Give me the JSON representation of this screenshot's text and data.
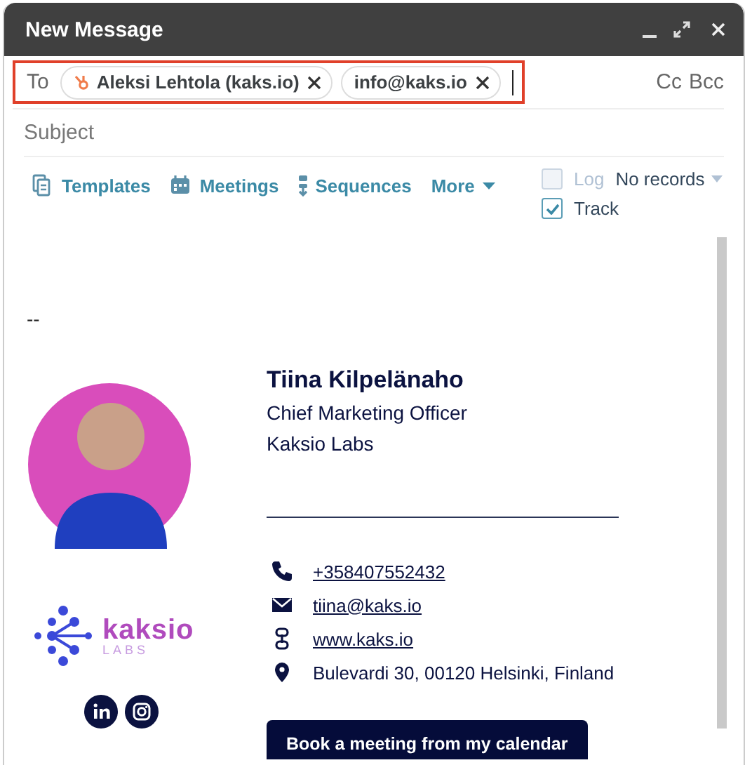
{
  "window": {
    "title": "New Message"
  },
  "recipients": {
    "label": "To",
    "chips": [
      {
        "text": "Aleksi Lehtola (kaks.io)",
        "kind": "contact"
      },
      {
        "text": "info@kaks.io",
        "kind": "email"
      }
    ],
    "cc": "Cc",
    "bcc": "Bcc"
  },
  "subject": {
    "placeholder": "Subject"
  },
  "toolbar": {
    "items": [
      {
        "label": "Templates",
        "kind": "templates"
      },
      {
        "label": "Meetings",
        "kind": "meetings"
      },
      {
        "label": "Sequences",
        "kind": "sequences"
      },
      {
        "label": "More",
        "kind": "dropdown"
      }
    ],
    "log": {
      "label": "Log",
      "records": "No records",
      "checked": false,
      "disabled": true
    },
    "track": {
      "label": "Track",
      "checked": true,
      "disabled": false
    }
  },
  "body": {
    "separator": "--",
    "signature": {
      "name": "Tiina Kilpelänaho",
      "title": "Chief Marketing Officer",
      "company": "Kaksio Labs",
      "logo_word": "kaksio",
      "logo_sub": "LABS",
      "contacts": [
        {
          "kind": "phone",
          "text": "+358407552432",
          "link": true
        },
        {
          "kind": "email",
          "text": "tiina@kaks.io",
          "link": true
        },
        {
          "kind": "web",
          "text": "www.kaks.io",
          "link": true
        },
        {
          "kind": "address",
          "text": "Bulevardi 30, 00120 Helsinki, Finland",
          "link": false
        }
      ],
      "button": "Book a meeting from my calendar"
    }
  }
}
